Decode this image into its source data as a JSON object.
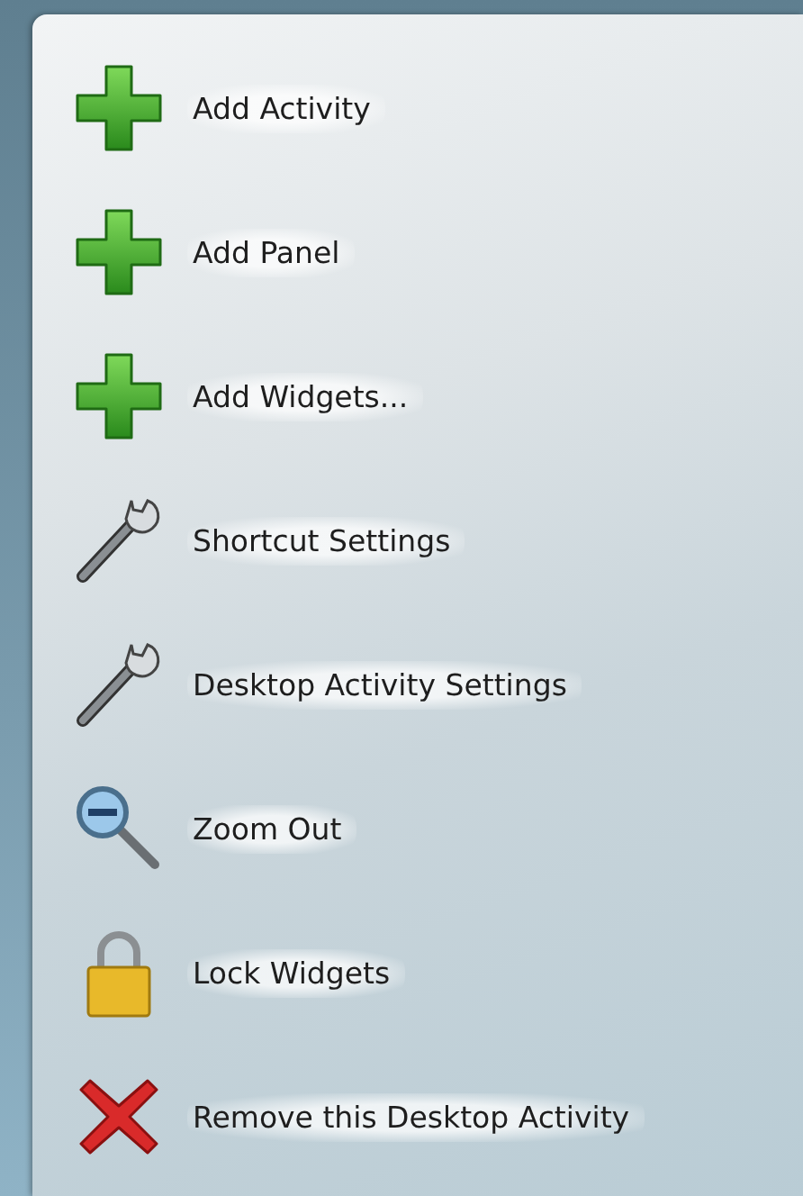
{
  "toolbox": {
    "items": [
      {
        "kind": "add",
        "label": "Add Activity"
      },
      {
        "kind": "add",
        "label": "Add Panel"
      },
      {
        "kind": "add",
        "label": "Add Widgets..."
      },
      {
        "kind": "settings",
        "label": "Shortcut Settings"
      },
      {
        "kind": "settings",
        "label": "Desktop Activity Settings"
      },
      {
        "kind": "zoom-out",
        "label": "Zoom Out"
      },
      {
        "kind": "lock",
        "label": "Lock Widgets"
      },
      {
        "kind": "remove",
        "label": "Remove this Desktop Activity"
      }
    ]
  }
}
